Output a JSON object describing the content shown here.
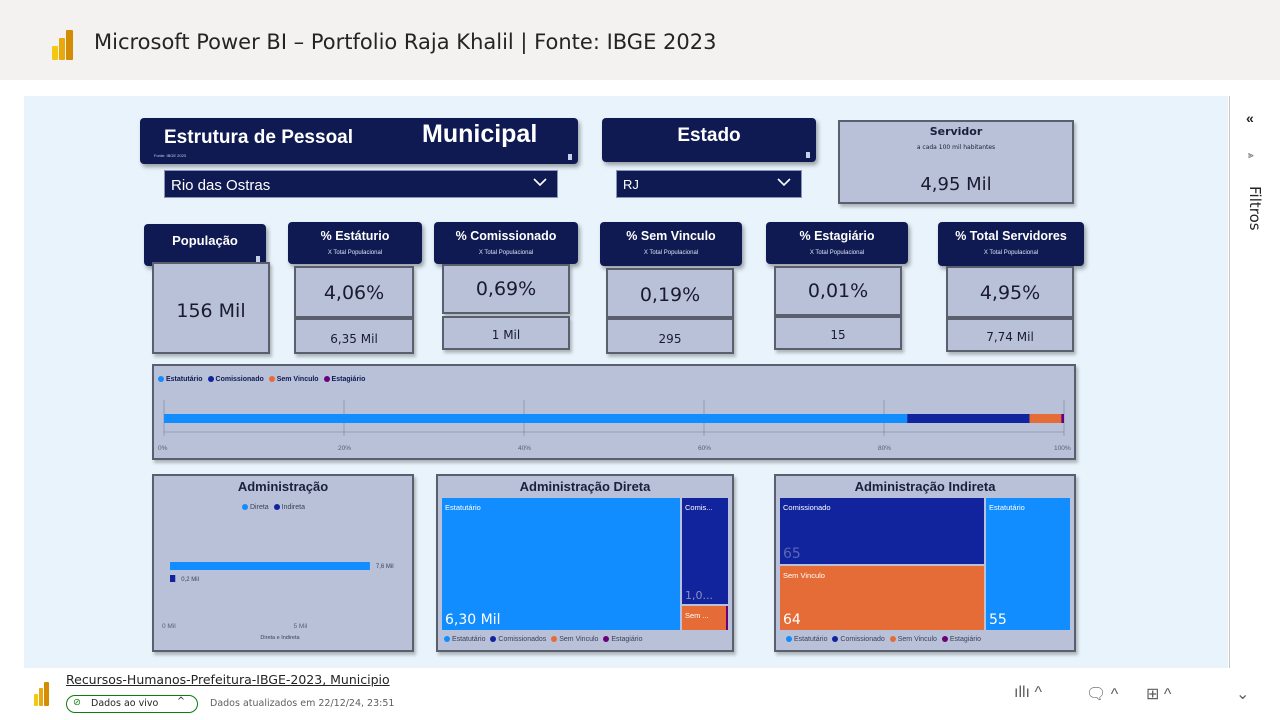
{
  "window": {
    "title": "Microsoft Power BI – Portfolio Raja Khalil | Fonte: IBGE 2023"
  },
  "filters_pane": {
    "label": "Filtros"
  },
  "header": {
    "title_left": "Estrutura de Pessoal",
    "title_right": "Municipal",
    "source_note": "Fonte: IBGE 2023",
    "municipio_value": "Rio das Ostras"
  },
  "estado": {
    "title": "Estado",
    "value": "RJ"
  },
  "servidor": {
    "title": "Servidor",
    "subtitle": "a cada 100 mil habitantes",
    "value": "4,95 Mil"
  },
  "populacao": {
    "title": "População",
    "value": "156 Mil"
  },
  "kpis": [
    {
      "title": "% Estáturio",
      "subtitle": "X Total Populacional",
      "pct": "4,06%",
      "count": "6,35 Mil"
    },
    {
      "title": "% Comissionado",
      "subtitle": "X Total Populacional",
      "pct": "0,69%",
      "count": "1 Mil"
    },
    {
      "title": "% Sem Vinculo",
      "subtitle": "X Total Populacional",
      "pct": "0,19%",
      "count": "295"
    },
    {
      "title": "% Estagiário",
      "subtitle": "X Total Populacional",
      "pct": "0,01%",
      "count": "15"
    },
    {
      "title": "% Total Servidores",
      "subtitle": "X Total Populacional",
      "pct": "4,95%",
      "count": "7,74 Mil"
    }
  ],
  "stacked_bar": {
    "legend": [
      "Estatutário",
      "Comissionado",
      "Sem Vinculo",
      "Estagiário"
    ],
    "ticks": [
      "0%",
      "20%",
      "40%",
      "60%",
      "80%",
      "100%"
    ]
  },
  "admin_chart": {
    "title": "Administração",
    "legend": [
      "Direta",
      "Indireta"
    ],
    "bar_label_direta": "7,6 Mil",
    "bar_label_indireta": "0,2 Mil",
    "x_ticks": [
      "0 Mil",
      "5 Mil"
    ],
    "x_label": "Direta e Indireta"
  },
  "direta": {
    "title": "Administração Direta",
    "cells": [
      {
        "label": "Estatutário",
        "value": "6,30 Mil"
      },
      {
        "label": "Comis...",
        "value": "1,0..."
      },
      {
        "label": "Sem ...",
        "value": ""
      }
    ],
    "legend": [
      "Estatutário",
      "Comissionados",
      "Sem Vinculo",
      "Estagiário"
    ]
  },
  "indireta": {
    "title": "Administração Indireta",
    "cells": [
      {
        "label": "Comissionado",
        "value": "65"
      },
      {
        "label": "Sem Vinculo",
        "value": "64"
      },
      {
        "label": "Estatutário",
        "value": "55"
      }
    ],
    "legend": [
      "Estatutário",
      "Comissionado",
      "Sem Vinculo",
      "Estagiário"
    ]
  },
  "colors": {
    "estatutario": "#118dff",
    "comissionado": "#12239e",
    "sem_vinculo": "#e66c37",
    "estagiario": "#6b007b",
    "navy": "#0f1a52"
  },
  "chart_data": [
    {
      "type": "bar",
      "orientation": "horizontal",
      "stacked": "100%",
      "categories": [
        ""
      ],
      "series": [
        {
          "name": "Estatutário",
          "values": [
            82
          ]
        },
        {
          "name": "Comissionado",
          "values": [
            13.5
          ]
        },
        {
          "name": "Sem Vinculo",
          "values": [
            3.5
          ]
        },
        {
          "name": "Estagiário",
          "values": [
            0.3
          ]
        }
      ],
      "xlim": [
        0,
        100
      ]
    },
    {
      "type": "bar",
      "orientation": "horizontal",
      "title": "Administração",
      "categories": [
        "Direta",
        "Indireta"
      ],
      "values": [
        7.6,
        0.2
      ],
      "xlabel": "Direta e Indireta"
    }
  ],
  "footer": {
    "report_name": "Recursos-Humanos-Prefeitura-IBGE-2023, Municipio",
    "live_label": "Dados ao vivo",
    "updated_text": "Dados atualizados em 22/12/24, 23:51"
  }
}
